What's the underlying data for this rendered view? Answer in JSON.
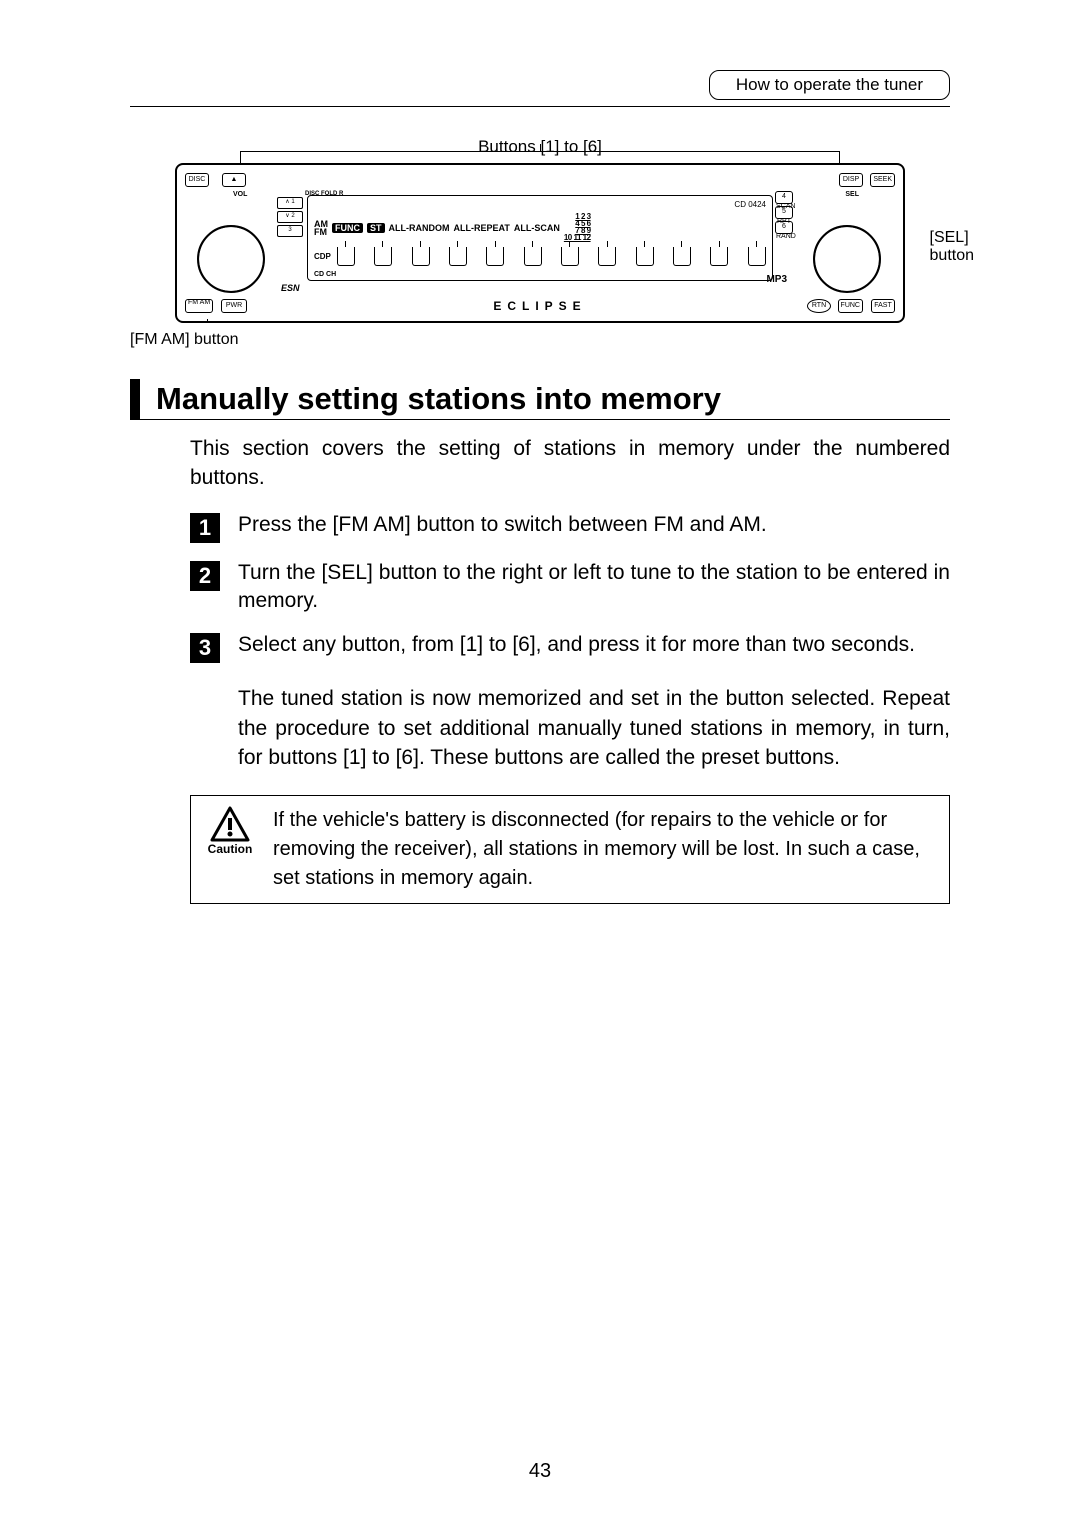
{
  "header": {
    "title": "How to operate the tuner"
  },
  "labels": {
    "buttons_1_6": "Buttons [1] to [6]",
    "sel_button": "[SEL]\nbutton",
    "fm_am_button": "[FM AM] button"
  },
  "stereo": {
    "btn_disc": "DISC",
    "btn_eject": "▲",
    "btn_disp": "DISP",
    "btn_seek": "SEEK",
    "btn_fmam": "FM\nAM",
    "btn_pwr": "PWR",
    "btn_rtn": "RTN",
    "btn_func": "FUNC",
    "btn_fast": "FAST",
    "label_vol": "VOL",
    "label_sel": "SEL",
    "uc_up": "∧ 1",
    "uc_dn": "∨ 2",
    "uc_3": "3",
    "uc_fold": "DISC\nFOLD R",
    "presets": [
      "4 SCAN",
      "5 RPT",
      "6 RAND"
    ],
    "lcd_cd": "CD 0424",
    "lcd_am": "AM",
    "lcd_fm": "FM",
    "lcd_st": "ST",
    "lcd_func": "FUNC",
    "lcd_cdp": "CDP",
    "lcd_cdch": "CD\nCH",
    "lcd_allrand": "ALL-RANDOM",
    "lcd_allrep": "ALL-REPEAT",
    "lcd_allscan": "ALL-SCAN",
    "num_col": [
      "1 2 3",
      "4 5 6",
      "7 8 9",
      "10 11 12"
    ],
    "brand": "ECLIPSE",
    "esn": "ESN",
    "mp3": "MP3"
  },
  "section_title": "Manually setting stations into memory",
  "intro": "This section covers the setting of stations in memory under the numbered buttons.",
  "steps": [
    {
      "n": "1",
      "text": "Press the [FM AM] button to switch between FM and AM."
    },
    {
      "n": "2",
      "text": "Turn the [SEL] button to the right or left to tune to the station to be entered in memory."
    },
    {
      "n": "3",
      "text": "Select any button, from [1] to [6], and press it for more than two seconds."
    }
  ],
  "step3_body": "The tuned station is now memorized and set in the button selected. Repeat the procedure to set additional manually tuned stations in memory, in turn, for buttons [1] to [6]. These buttons are called the preset buttons.",
  "caution": {
    "label": "Caution",
    "text": "If the vehicle's battery is disconnected (for repairs to the vehicle or for removing the receiver), all stations in memory will be lost. In such a case, set stations in memory again."
  },
  "page_number": "43"
}
